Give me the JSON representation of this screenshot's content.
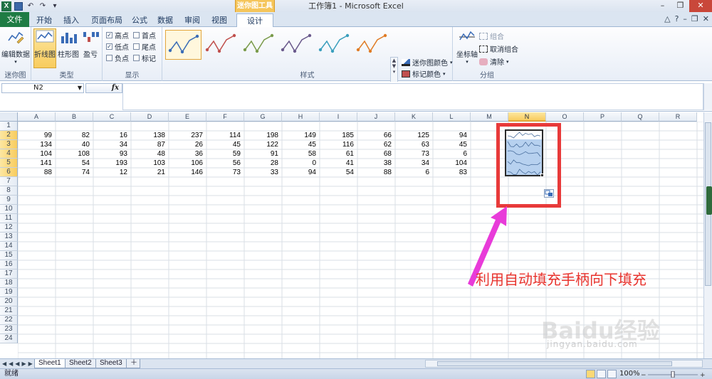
{
  "window": {
    "title": "工作簿1 - Microsoft Excel",
    "context_tab_group": "迷你图工具"
  },
  "tabs": [
    {
      "label": "文件"
    },
    {
      "label": "开始"
    },
    {
      "label": "插入"
    },
    {
      "label": "页面布局"
    },
    {
      "label": "公式"
    },
    {
      "label": "数据"
    },
    {
      "label": "审阅"
    },
    {
      "label": "视图"
    },
    {
      "label": "设计"
    }
  ],
  "ribbon": {
    "sparkline_group": {
      "edit_data": "编辑数据",
      "label": "迷你图"
    },
    "type_group": {
      "line": "折线图",
      "column": "柱形图",
      "winloss": "盈亏",
      "label": "类型"
    },
    "show_group": {
      "label": "显示",
      "items": [
        {
          "label": "高点",
          "checked": true
        },
        {
          "label": "低点",
          "checked": true
        },
        {
          "label": "负点",
          "checked": false
        },
        {
          "label": "首点",
          "checked": false
        },
        {
          "label": "尾点",
          "checked": false
        },
        {
          "label": "标记",
          "checked": false
        }
      ]
    },
    "style_group": {
      "label": "样式",
      "swatch_colors": [
        "#3a6cb7",
        "#c0504d",
        "#7a9b4b",
        "#6a5a8c",
        "#3b9fbd",
        "#e07c26"
      ],
      "sparkline_color": "迷你图颜色",
      "marker_color": "标记颜色"
    },
    "group_group": {
      "axis": "坐标轴",
      "group": "组合",
      "ungroup": "取消组合",
      "clear": "清除",
      "label": "分组"
    }
  },
  "formula_bar": {
    "name_box": "N2",
    "fx": "fx",
    "formula": ""
  },
  "sheet": {
    "columns": [
      "A",
      "B",
      "C",
      "D",
      "E",
      "F",
      "G",
      "H",
      "I",
      "J",
      "K",
      "L",
      "M",
      "N",
      "O",
      "P",
      "Q",
      "R"
    ],
    "selected_column": "N",
    "row_count": 24,
    "rows": [
      [
        99,
        82,
        16,
        138,
        237,
        114,
        198,
        149,
        185,
        66,
        125,
        94
      ],
      [
        134,
        40,
        34,
        87,
        26,
        45,
        122,
        45,
        116,
        62,
        63,
        45
      ],
      [
        104,
        108,
        93,
        48,
        36,
        59,
        91,
        58,
        61,
        68,
        73,
        6
      ],
      [
        141,
        54,
        193,
        103,
        106,
        56,
        28,
        0,
        41,
        38,
        34,
        104
      ],
      [
        88,
        74,
        12,
        21,
        146,
        73,
        33,
        94,
        54,
        88,
        6,
        83
      ]
    ]
  },
  "annotation": {
    "text": "利用自动填充手柄向下填充"
  },
  "sheet_tabs": [
    {
      "label": "Sheet1"
    },
    {
      "label": "Sheet2"
    },
    {
      "label": "Sheet3"
    }
  ],
  "status": {
    "ready": "就绪",
    "zoom": "100%"
  },
  "watermark": {
    "brand": "Baidu经验",
    "url": "jingyan.baidu.com"
  }
}
